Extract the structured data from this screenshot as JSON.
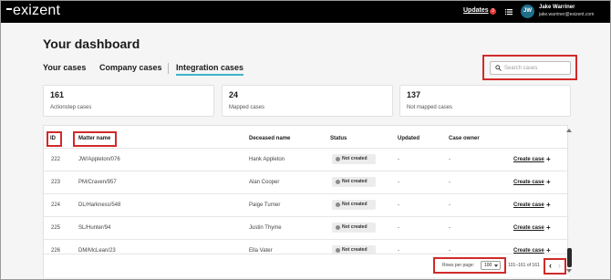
{
  "app": {
    "logo": "exizent"
  },
  "topbar": {
    "updates_label": "Updates",
    "updates_count": "3",
    "user": {
      "initials": "JW",
      "name": "Jake Warriner",
      "email": "jake.warriner@exizent.com"
    }
  },
  "page": {
    "title": "Your dashboard"
  },
  "tabs": [
    {
      "label": "Your cases"
    },
    {
      "label": "Company cases"
    },
    {
      "label": "Integration cases"
    }
  ],
  "search": {
    "placeholder": "Search cases"
  },
  "stats": [
    {
      "value": "161",
      "label": "Actionstep cases"
    },
    {
      "value": "24",
      "label": "Mapped cases"
    },
    {
      "value": "137",
      "label": "Not mapped cases"
    }
  ],
  "table": {
    "headers": {
      "id": "ID",
      "matter": "Matter name",
      "deceased": "Deceased name",
      "status": "Status",
      "updated": "Updated",
      "owner": "Case owner"
    },
    "action_label": "Create case",
    "action_icon": "plus-icon",
    "rows": [
      {
        "id": "222",
        "matter": "JW/Appleton/076",
        "deceased": "Hank Appleton",
        "status": "Not created",
        "updated": "-",
        "owner": "-"
      },
      {
        "id": "223",
        "matter": "PM/Craven/957",
        "deceased": "Alan Cooper",
        "status": "Not created",
        "updated": "-",
        "owner": "-"
      },
      {
        "id": "224",
        "matter": "DL/Harkness/548",
        "deceased": "Paige Turner",
        "status": "Not created",
        "updated": "-",
        "owner": "-"
      },
      {
        "id": "225",
        "matter": "SL/Hunter/94",
        "deceased": "Justin Thyme",
        "status": "Not created",
        "updated": "-",
        "owner": "-"
      },
      {
        "id": "226",
        "matter": "DM/McLean/23",
        "deceased": "Ella Vater",
        "status": "Not created",
        "updated": "-",
        "owner": "-"
      }
    ],
    "pagination": {
      "rows_per_page_label": "Rows per page:",
      "rows_per_page_value": "100",
      "range": "101–161 of 161"
    }
  },
  "colors": {
    "accent": "#3fb3ce",
    "highlight": "#d12a2a",
    "avatar": "#1f6f8b",
    "topbar": "#000000"
  }
}
